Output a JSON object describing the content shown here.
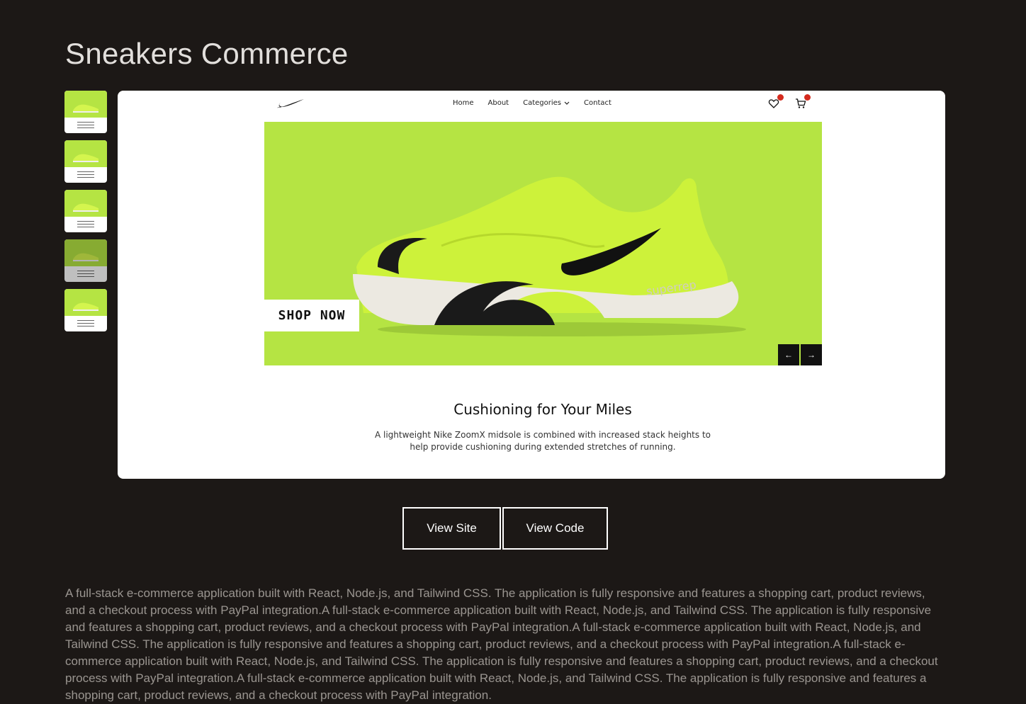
{
  "page": {
    "title": "Sneakers Commerce"
  },
  "thumbnails": [
    {
      "id": 1,
      "dim": false
    },
    {
      "id": 2,
      "dim": false
    },
    {
      "id": 3,
      "dim": false
    },
    {
      "id": 4,
      "dim": true
    },
    {
      "id": 5,
      "dim": false
    }
  ],
  "preview": {
    "nav": {
      "links": [
        "Home",
        "About",
        "Categories",
        "Contact"
      ],
      "icons": [
        "heart-icon",
        "cart-icon"
      ]
    },
    "hero": {
      "shop_label": "SHOP NOW",
      "prev_glyph": "←",
      "next_glyph": "→",
      "shoe_text": "superrep"
    },
    "heading": "Cushioning for Your Miles",
    "description": "A lightweight Nike ZoomX midsole is combined with increased stack heights to help provide cushioning during extended stretches of running."
  },
  "actions": {
    "view_site": "View Site",
    "view_code": "View Code"
  },
  "description": "A full-stack e-commerce application built with React, Node.js, and Tailwind CSS. The application is fully responsive and features a shopping cart, product reviews, and a checkout process with PayPal integration.A full-stack e-commerce application built with React, Node.js, and Tailwind CSS. The application is fully responsive and features a shopping cart, product reviews, and a checkout process with PayPal integration.A full-stack e-commerce application built with React, Node.js, and Tailwind CSS. The application is fully responsive and features a shopping cart, product reviews, and a checkout process with PayPal integration.A full-stack e-commerce application built with React, Node.js, and Tailwind CSS. The application is fully responsive and features a shopping cart, product reviews, and a checkout process with PayPal integration.A full-stack e-commerce application built with React, Node.js, and Tailwind CSS. The application is fully responsive and features a shopping cart, product reviews, and a checkout process with PayPal integration.",
  "colors": {
    "background": "#1c1816",
    "hero_green": "#b5e443",
    "badge_red": "#d52b1e"
  }
}
